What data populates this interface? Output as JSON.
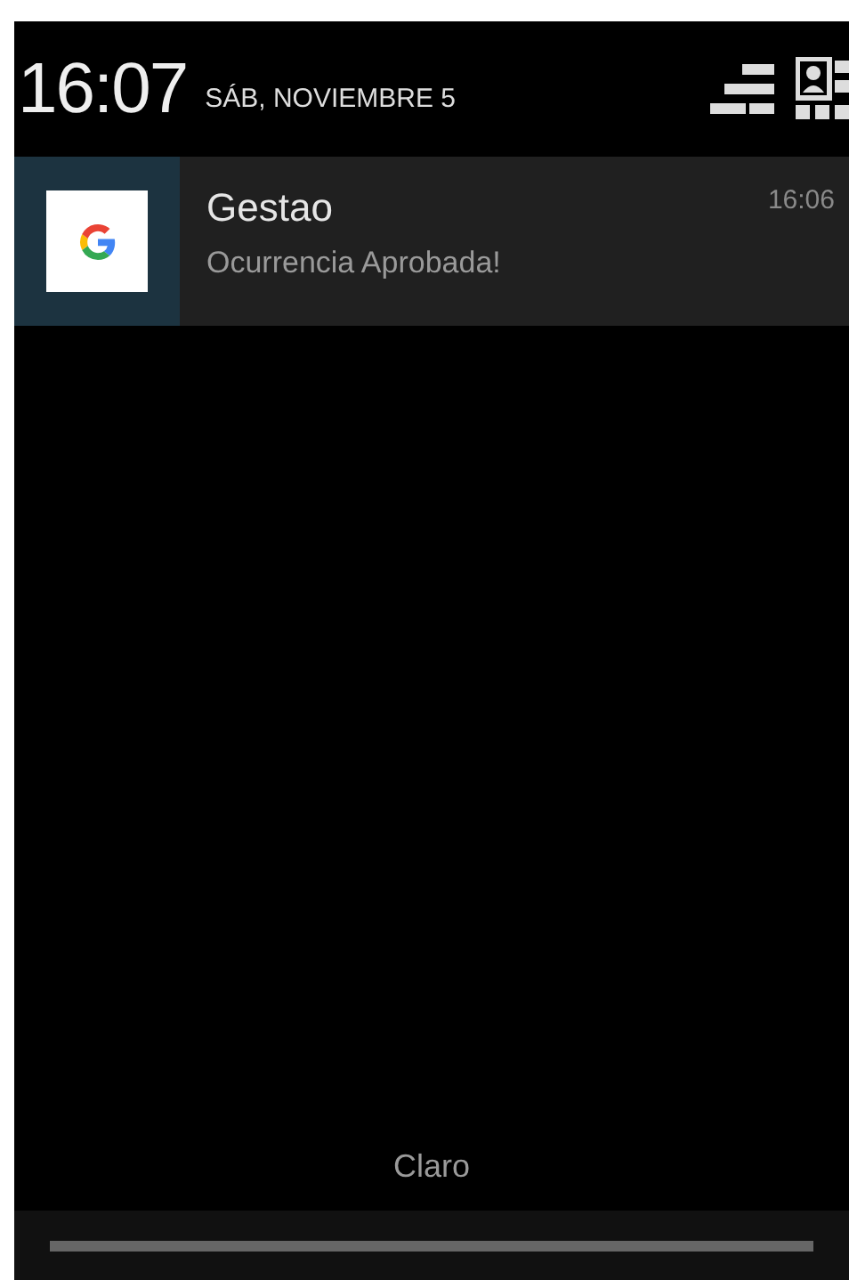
{
  "header": {
    "time": "16:07",
    "date": "SÁB, NOVIEMBRE 5"
  },
  "notifications": [
    {
      "app": "Gestao",
      "message": "Ocurrencia Aprobada!",
      "time": "16:06"
    }
  ],
  "carrier": "Claro"
}
